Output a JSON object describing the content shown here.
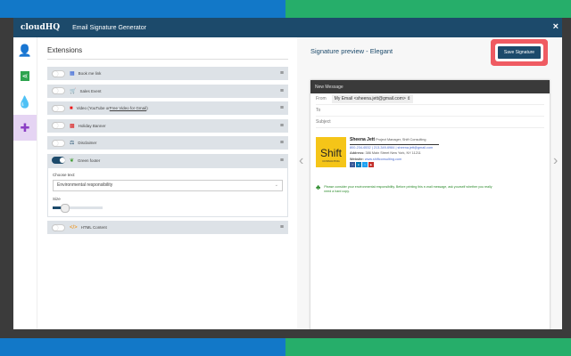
{
  "modal": {
    "logo": "cloudHQ",
    "title": "Email Signature Generator",
    "close": "×"
  },
  "sidebar": [
    "profile",
    "share",
    "style",
    "extensions"
  ],
  "extensions": {
    "heading": "Extensions",
    "items": [
      {
        "label": "Book me link",
        "icon": "📅",
        "on": false
      },
      {
        "label": "Sales Event",
        "icon": "🛒",
        "on": false
      },
      {
        "label": "Video (YouTube or ",
        "link": "Free Video for Gmail",
        "suffix": ")",
        "icon": "■",
        "on": false
      },
      {
        "label": "Holiday Banner",
        "icon": "🎁",
        "on": false
      },
      {
        "label": "Disclaimer",
        "icon": "⚖",
        "on": false
      },
      {
        "label": "Green footer",
        "icon": "🍃",
        "on": true
      },
      {
        "label": "HTML Content",
        "icon": "</>",
        "on": false
      }
    ],
    "choose_label": "Choose text:",
    "choose_value": "Environmental responsibility",
    "size_label": "Size",
    "size_value": 0.2
  },
  "preview": {
    "title": "Signature preview - Elegant",
    "save": "Save Signature",
    "compose_title": "New Message",
    "from_label": "From",
    "from_value": "My Email <sheena.jett@gmail.com> ⇕",
    "to_label": "To",
    "subject_label": "Subject",
    "sig": {
      "logo_main": "Shift",
      "logo_sub": "CONSULTING",
      "name": "Sheena Jett",
      "role": "Project Manager, Shift Consulting",
      "phones": "800-234-6532  |  213-349-6984  |  sheena.jett@gmail.com",
      "address_label": "Address:",
      "address": "386 Main Street New York, NY 11211",
      "website_label": "Website:",
      "website": "www.shiftconsulting.com",
      "social": [
        "f",
        "in",
        "t",
        "▶"
      ]
    },
    "green_text": "Please consider your environmental responsibility. Before printing this e-mail message, ask yourself whether you really need a hard copy."
  }
}
